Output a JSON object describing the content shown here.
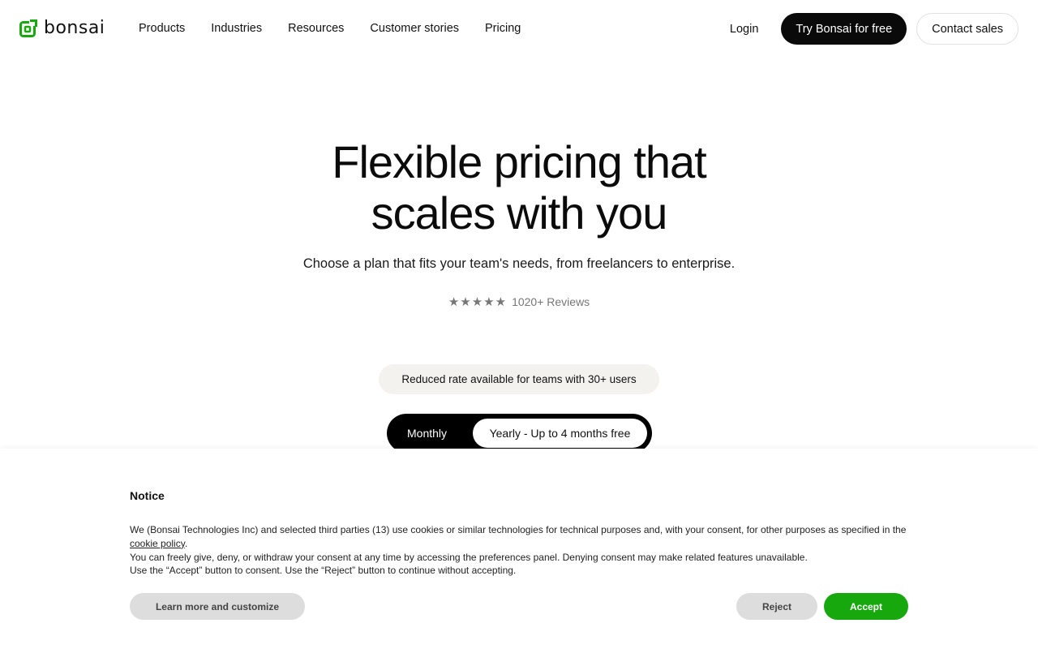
{
  "brand": {
    "name": "bonsai",
    "accent_color": "#17a80d"
  },
  "nav": {
    "items": [
      "Products",
      "Industries",
      "Resources",
      "Customer stories",
      "Pricing"
    ]
  },
  "header": {
    "login_label": "Login",
    "try_label": "Try Bonsai for free",
    "contact_label": "Contact sales"
  },
  "hero": {
    "title_line1": "Flexible pricing that",
    "title_line2": "scales with you",
    "subtitle": "Choose a plan that fits your team's needs, from freelancers to enterprise.",
    "stars": "★★★★★",
    "rating": 5,
    "reviews_label": "1020+ Reviews"
  },
  "promo": {
    "reduced_rate": "Reduced rate available for teams with 30+ users"
  },
  "billing_toggle": {
    "monthly_label": "Monthly",
    "yearly_label": "Yearly - Up to 4 months free",
    "selected": "yearly"
  },
  "cookie_notice": {
    "title": "Notice",
    "body_part1": "We (Bonsai Technologies Inc) and selected third parties (13) use cookies or similar technologies for technical purposes and, with your consent, for other purposes as specified in the ",
    "link_text": "cookie policy",
    "body_part2": ".",
    "body_line2": "You can freely give, deny, or withdraw your consent at any time by accessing the preferences panel. Denying consent may make related features unavailable.",
    "body_line3": "Use the “Accept” button to consent. Use the “Reject” button to continue without accepting.",
    "learn_more_label": "Learn more and customize",
    "reject_label": "Reject",
    "accept_label": "Accept"
  }
}
